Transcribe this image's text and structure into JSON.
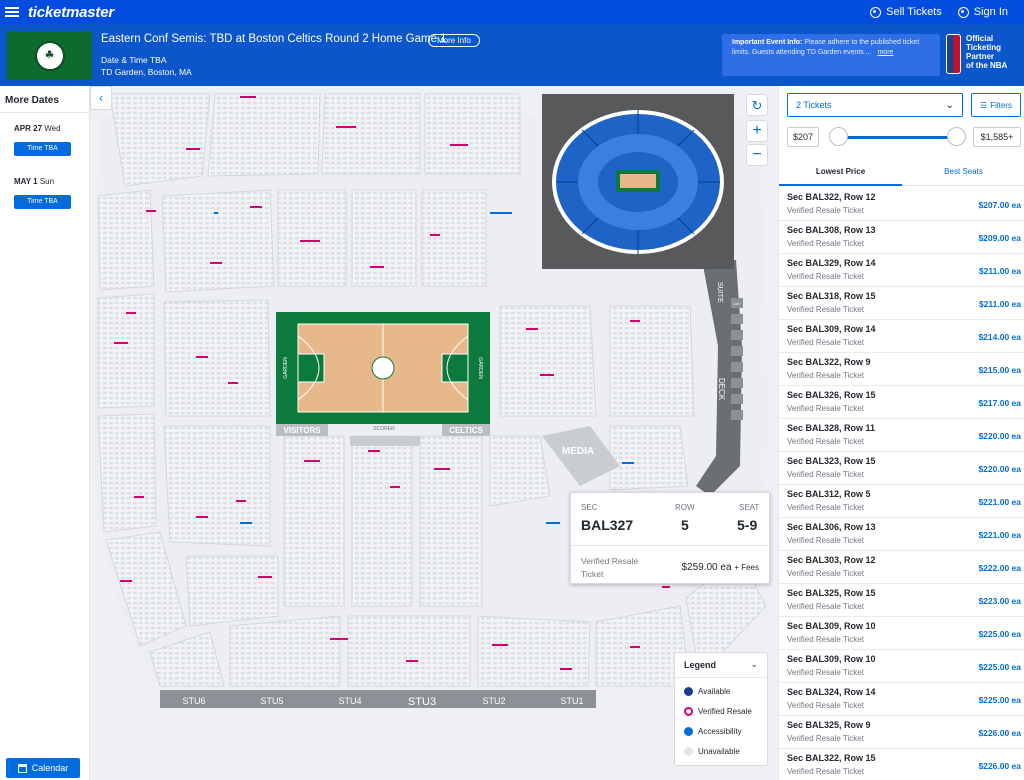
{
  "nav": {
    "logo": "ticketmaster",
    "sell": "Sell Tickets",
    "signin": "Sign In"
  },
  "event": {
    "title": "Eastern Conf Semis: TBD at Boston Celtics Round 2 Home Game 1",
    "more_info": "More Info",
    "date": "Date & Time TBA",
    "venue": "TD Garden, Boston, MA",
    "notice_bold": "Important Event Info:",
    "notice_text": "Please adhere to the published ticket limits. Guests attending TD Garden events ...",
    "notice_more": "more",
    "partner": [
      "Official",
      "Ticketing",
      "Partner",
      "of the NBA"
    ]
  },
  "dates": {
    "heading": "More Dates",
    "items": [
      {
        "date": "APR 27",
        "day": "Wed",
        "button": "Time TBA"
      },
      {
        "date": "MAY 1",
        "day": "Sun",
        "button": "Time TBA"
      }
    ],
    "calendar": "Calendar"
  },
  "map": {
    "labels": {
      "visitors": "VISITORS",
      "scorer": "SCORER",
      "celtics": "CELTICS",
      "media": "MEDIA",
      "suite": "SUITE",
      "deck": "DECK",
      "loft": "LOFT",
      "garden_left": "GARDEN",
      "garden_right": "GARDEN"
    },
    "stu": [
      "STU6",
      "STU5",
      "STU4",
      "STU3",
      "STU2",
      "STU1"
    ],
    "tooltip": {
      "sec_label": "SEC",
      "sec": "BAL327",
      "row_label": "ROW",
      "row": "5",
      "seat_label": "SEAT",
      "seat": "5-9",
      "type": "Verified Resale Ticket",
      "price": "$259.00 ea",
      "fees": "+ Fees"
    },
    "legend": {
      "title": "Legend",
      "items": [
        {
          "label": "Available",
          "color": "#026cdf"
        },
        {
          "label": "Verified Resale",
          "color": "#d6006e"
        },
        {
          "label": "Accessibility",
          "color": "#026cdf"
        },
        {
          "label": "Unavailable",
          "color": "#e3e6ea"
        }
      ]
    }
  },
  "panel": {
    "quantity": "2 Tickets",
    "filters": "Filters",
    "price_min": "$207",
    "price_max": "$1,585+",
    "tabs": [
      "Lowest Price",
      "Best Seats"
    ],
    "listings": [
      {
        "sec": "Sec BAL322, Row 12",
        "type": "Verified Resale Ticket",
        "price": "$207.00 ea"
      },
      {
        "sec": "Sec BAL308, Row 13",
        "type": "Verified Resale Ticket",
        "price": "$209.00 ea"
      },
      {
        "sec": "Sec BAL329, Row 14",
        "type": "Verified Resale Ticket",
        "price": "$211.00 ea"
      },
      {
        "sec": "Sec BAL318, Row 15",
        "type": "Verified Resale Ticket",
        "price": "$211.00 ea"
      },
      {
        "sec": "Sec BAL309, Row 14",
        "type": "Verified Resale Ticket",
        "price": "$214.00 ea"
      },
      {
        "sec": "Sec BAL322, Row 9",
        "type": "Verified Resale Ticket",
        "price": "$215.00 ea"
      },
      {
        "sec": "Sec BAL326, Row 15",
        "type": "Verified Resale Ticket",
        "price": "$217.00 ea"
      },
      {
        "sec": "Sec BAL328, Row 11",
        "type": "Verified Resale Ticket",
        "price": "$220.00 ea"
      },
      {
        "sec": "Sec BAL323, Row 15",
        "type": "Verified Resale Ticket",
        "price": "$220.00 ea"
      },
      {
        "sec": "Sec BAL312, Row 5",
        "type": "Verified Resale Ticket",
        "price": "$221.00 ea"
      },
      {
        "sec": "Sec BAL306, Row 13",
        "type": "Verified Resale Ticket",
        "price": "$221.00 ea"
      },
      {
        "sec": "Sec BAL303, Row 12",
        "type": "Verified Resale Ticket",
        "price": "$222.00 ea"
      },
      {
        "sec": "Sec BAL325, Row 15",
        "type": "Verified Resale Ticket",
        "price": "$223.00 ea"
      },
      {
        "sec": "Sec BAL309, Row 10",
        "type": "Verified Resale Ticket",
        "price": "$225.00 ea"
      },
      {
        "sec": "Sec BAL309, Row 10",
        "type": "Verified Resale Ticket",
        "price": "$225.00 ea"
      },
      {
        "sec": "Sec BAL324, Row 14",
        "type": "Verified Resale Ticket",
        "price": "$225.00 ea"
      },
      {
        "sec": "Sec BAL325, Row 9",
        "type": "Verified Resale Ticket",
        "price": "$226.00 ea"
      },
      {
        "sec": "Sec BAL322, Row 15",
        "type": "Verified Resale Ticket",
        "price": "$226.00 ea"
      }
    ]
  }
}
